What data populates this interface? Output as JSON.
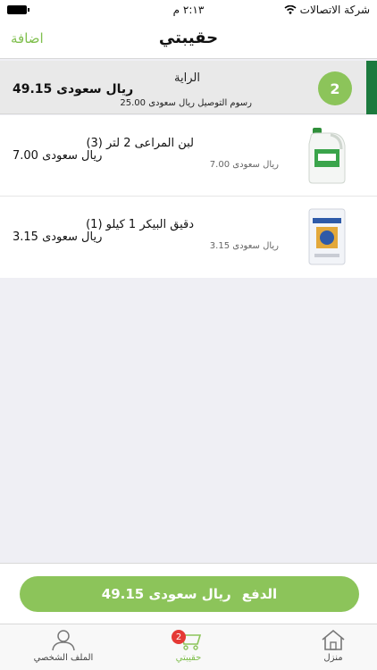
{
  "status_bar": {
    "carrier": "شركة الاتصالات",
    "time": "٢:١٣ م"
  },
  "nav": {
    "title": "حقيبتي",
    "add_label": "اضافة"
  },
  "store": {
    "count": "2",
    "name": "الراية",
    "total": "ريال سعودى 49.15",
    "delivery_fee": "رسوم التوصيل ريال سعودى 25.00"
  },
  "items": [
    {
      "name": "لبن المراعى 2 لتر (3)",
      "unit_price": "ريال سعودى 7.00",
      "total": "ريال سعودى 7.00",
      "image": "milk-jug"
    },
    {
      "name": "دقيق البيكر 1 كيلو (1)",
      "unit_price": "ريال سعودى 3.15",
      "total": "ريال سعودى 3.15",
      "image": "flour-bag"
    }
  ],
  "checkout": {
    "pay_label": "الدفع",
    "amount": "ريال سعودى 49.15"
  },
  "tabs": [
    {
      "label": "منزل",
      "icon": "home-icon"
    },
    {
      "label": "حقيبتي",
      "icon": "cart-icon",
      "badge": "2"
    },
    {
      "label": "الملف الشخصي",
      "icon": "person-icon"
    }
  ],
  "colors": {
    "accent": "#8cc45a",
    "store_bar": "#1c7a3e",
    "badge": "#e53935"
  }
}
